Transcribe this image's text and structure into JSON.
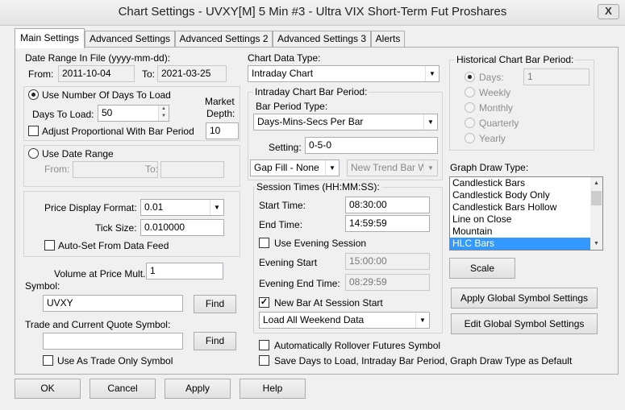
{
  "window": {
    "title": "Chart Settings - UVXY[M]  5 Min   #3 - Ultra VIX Short-Term Fut Proshares",
    "close_label": "X"
  },
  "tabs": [
    "Main Settings",
    "Advanced Settings",
    "Advanced Settings 2",
    "Advanced Settings 3",
    "Alerts"
  ],
  "date_range": {
    "title": "Date Range In File (yyyy-mm-dd):",
    "from_label": "From:",
    "from_value": "2011-10-04",
    "to_label": "To:",
    "to_value": "2021-03-25"
  },
  "days_group": {
    "use_days_label": "Use Number Of Days To Load",
    "days_to_load_label": "Days To Load:",
    "days_to_load_value": "50",
    "market_depth_label_1": "Market",
    "market_depth_label_2": "Depth:",
    "market_depth_value": "10",
    "adjust_label": "Adjust Proportional With Bar Period"
  },
  "date_range_group": {
    "use_date_range_label": "Use Date Range",
    "from_label": "From:",
    "to_label": "To:"
  },
  "price_group": {
    "price_display_format_label": "Price Display Format:",
    "price_display_format_value": "0.01",
    "tick_size_label": "Tick Size:",
    "tick_size_value": "0.010000",
    "auto_set_label": "Auto-Set From Data Feed"
  },
  "volume": {
    "label": "Volume at Price Mult.:",
    "value": "1"
  },
  "symbol": {
    "label": "Symbol:",
    "value": "UVXY",
    "find_label": "Find"
  },
  "trade_symbol": {
    "label": "Trade and Current Quote Symbol:",
    "value": "",
    "find_label": "Find",
    "trade_only_label": "Use As Trade Only Symbol"
  },
  "chart_data_type": {
    "label": "Chart Data Type:",
    "value": "Intraday Chart"
  },
  "intraday_bar": {
    "title": "Intraday Chart Bar Period:",
    "bar_period_type_label": "Bar Period Type:",
    "bar_period_type_value": "Days-Mins-Secs Per Bar",
    "setting_label": "Setting:",
    "setting_value": "0-5-0",
    "gap_fill_value": "Gap Fill - None",
    "new_trend_value": "New Trend Bar W"
  },
  "session": {
    "title": "Session Times (HH:MM:SS):",
    "start_label": "Start Time:",
    "start_value": "08:30:00",
    "end_label": "End Time:",
    "end_value": "14:59:59",
    "use_evening_label": "Use Evening Session",
    "evening_start_label": "Evening Start",
    "evening_start_value": "15:00:00",
    "evening_end_label": "Evening End Time:",
    "evening_end_value": "08:29:59",
    "new_bar_label": "New Bar At Session Start",
    "weekend_value": "Load All Weekend Data"
  },
  "rollover_label": "Automatically Rollover Futures Symbol",
  "save_default_label": "Save Days to Load, Intraday Bar Period, Graph Draw Type as Default",
  "historical": {
    "title": "Historical Chart Bar Period:",
    "days_label": "Days:",
    "days_value": "1",
    "weekly_label": "Weekly",
    "monthly_label": "Monthly",
    "quarterly_label": "Quarterly",
    "yearly_label": "Yearly"
  },
  "graph_draw": {
    "label": "Graph Draw Type:",
    "items": [
      "Candlestick Bars",
      "Candlestick Body Only",
      "Candlestick Bars Hollow",
      "Line on Close",
      "Mountain",
      "HLC Bars"
    ],
    "selected": "HLC Bars"
  },
  "buttons": {
    "scale": "Scale",
    "apply_global": "Apply Global Symbol Settings",
    "edit_global": "Edit Global Symbol Settings",
    "ok": "OK",
    "cancel": "Cancel",
    "apply": "Apply",
    "help": "Help"
  },
  "colors": {
    "selection": "#3399ff",
    "window_bg": "#f0f0f0"
  }
}
